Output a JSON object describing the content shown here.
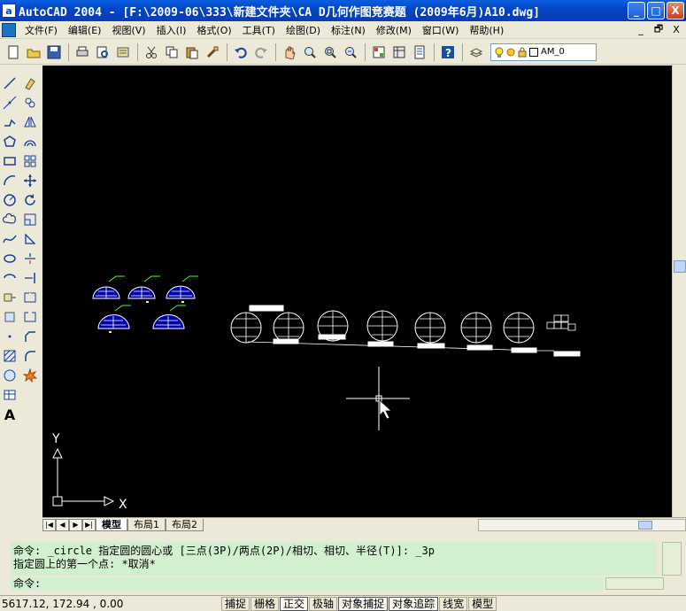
{
  "window": {
    "title": "AutoCAD 2004 - [F:\\2009-06\\333\\新建文件夹\\CA D几何作图竞赛题 (2009年6月)A10.dwg]",
    "app_icon": "a",
    "minimize": "_",
    "maximize": "□",
    "close": "X"
  },
  "menubar": {
    "items": [
      "文件(F)",
      "编辑(E)",
      "视图(V)",
      "插入(I)",
      "格式(O)",
      "工具(T)",
      "绘图(D)",
      "标注(N)",
      "修改(M)",
      "窗口(W)",
      "帮助(H)"
    ],
    "mdi_min": "_",
    "mdi_restore": "🗗",
    "mdi_close": "X"
  },
  "toolbar": {
    "layer_name": "AM_0"
  },
  "left_toolbar_1": {
    "text_tool": "A"
  },
  "drawing": {
    "ucs_x": "X",
    "ucs_y": "Y"
  },
  "tabs": [
    "模型",
    "布局1",
    "布局2"
  ],
  "command": {
    "history": [
      "命令: _circle 指定圆的圆心或 [三点(3P)/两点(2P)/相切、相切、半径(T)]: _3p",
      "指定圆上的第一个点: *取消*"
    ],
    "prompt": "命令:"
  },
  "status": {
    "coords": "5617.12, 172.94 , 0.00",
    "buttons": [
      "捕捉",
      "栅格",
      "正交",
      "极轴",
      "对象捕捉",
      "对象追踪",
      "线宽",
      "模型"
    ]
  },
  "icons": {
    "standard": [
      "new-icon",
      "open-icon",
      "save-icon",
      "print-icon",
      "preview-icon",
      "publish-icon",
      "cut-icon",
      "copy-icon",
      "paste-icon",
      "match-properties-icon",
      "undo-icon",
      "redo-icon",
      "pan-icon",
      "zoom-realtime-icon",
      "zoom-window-icon",
      "zoom-previous-icon",
      "properties-icon",
      "design-center-icon",
      "tool-palettes-icon",
      "help-icon"
    ],
    "layer": [
      "layer-manager-icon",
      "bulb-icon",
      "sun-icon",
      "lock-icon"
    ]
  },
  "colors": {
    "titlebar": "#0a3cb4",
    "drawing_bg": "#000000",
    "command_bg": "#d2f0d0"
  }
}
